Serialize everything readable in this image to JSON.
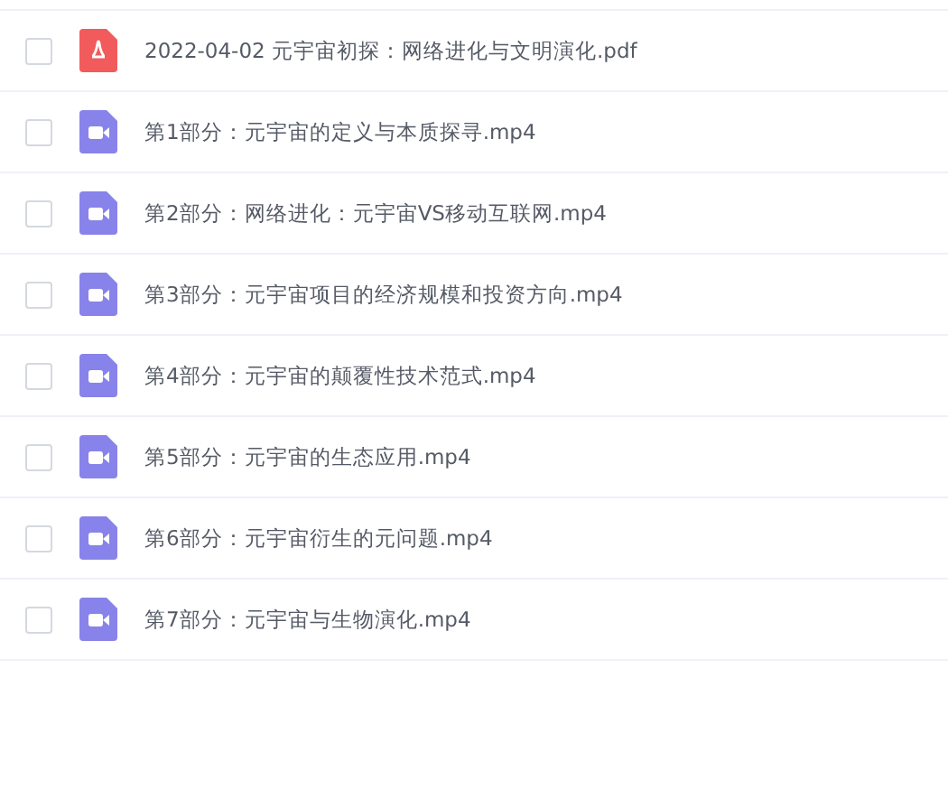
{
  "files": [
    {
      "kind": "pdf",
      "name": "2022-04-02 元宇宙初探：网络进化与文明演化.pdf",
      "checked": false
    },
    {
      "kind": "video",
      "name": "第1部分：元宇宙的定义与本质探寻.mp4",
      "checked": false
    },
    {
      "kind": "video",
      "name": "第2部分：网络进化：元宇宙VS移动互联网.mp4",
      "checked": false
    },
    {
      "kind": "video",
      "name": "第3部分：元宇宙项目的经济规模和投资方向.mp4",
      "checked": false
    },
    {
      "kind": "video",
      "name": "第4部分：元宇宙的颠覆性技术范式.mp4",
      "checked": false
    },
    {
      "kind": "video",
      "name": "第5部分：元宇宙的生态应用.mp4",
      "checked": false
    },
    {
      "kind": "video",
      "name": "第6部分：元宇宙衍生的元问题.mp4",
      "checked": false
    },
    {
      "kind": "video",
      "name": "第7部分：元宇宙与生物演化.mp4",
      "checked": false
    }
  ]
}
